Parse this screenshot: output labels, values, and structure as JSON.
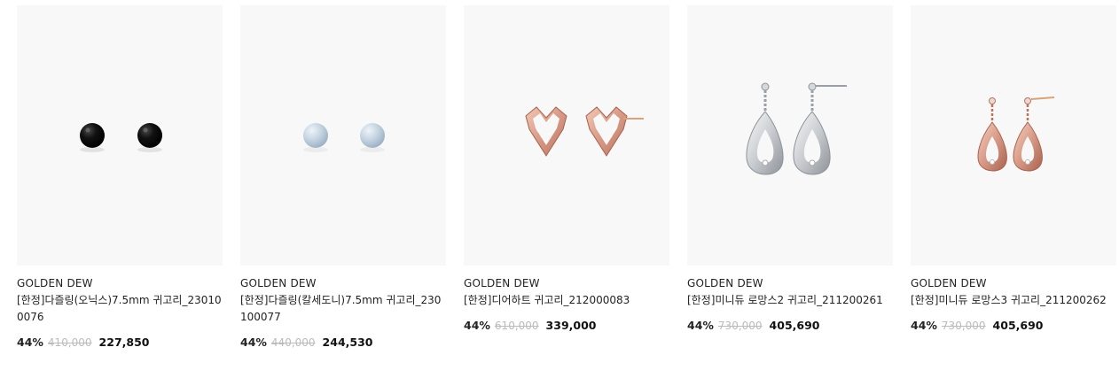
{
  "products": [
    {
      "brand": "GOLDEN DEW",
      "name": "[한정]다즐링(오닉스)7.5mm 귀고리_230100076",
      "discount": "44%",
      "original_price": "410,000",
      "sale_price": "227,850",
      "image_icon": "onyx-stud-earrings-image"
    },
    {
      "brand": "GOLDEN DEW",
      "name": "[한정]다즐링(칼세도니)7.5mm 귀고리_230100077",
      "discount": "44%",
      "original_price": "440,000",
      "sale_price": "244,530",
      "image_icon": "chalcedony-stud-earrings-image"
    },
    {
      "brand": "GOLDEN DEW",
      "name": "[한정]디어하트 귀고리_212000083",
      "discount": "44%",
      "original_price": "610,000",
      "sale_price": "339,000",
      "image_icon": "heart-earrings-image"
    },
    {
      "brand": "GOLDEN DEW",
      "name": "[한정]미니듀 로망스2 귀고리_211200261",
      "discount": "44%",
      "original_price": "730,000",
      "sale_price": "405,690",
      "image_icon": "silver-drop-earrings-image"
    },
    {
      "brand": "GOLDEN DEW",
      "name": "[한정]미니듀 로망스3 귀고리_211200262",
      "discount": "44%",
      "original_price": "730,000",
      "sale_price": "405,690",
      "image_icon": "rose-gold-drop-earrings-image"
    }
  ],
  "colors": {
    "image_bg": "#f8f8f8",
    "strike_price": "#bbbbbb",
    "text": "#222222",
    "onyx": "#111111",
    "chalcedony": "#c5d4e2",
    "rose_gold": "#d79a86",
    "silver": "#c9ccd0"
  }
}
